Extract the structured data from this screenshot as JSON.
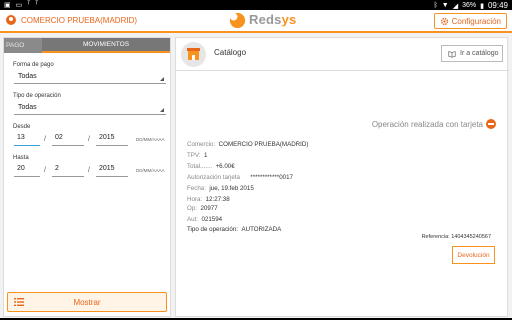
{
  "statusbar": {
    "left_icons": [
      "notification-icon",
      "tv-icon",
      "t-icon",
      "t2-icon"
    ],
    "left_glyphs": [
      "▣",
      "▭",
      "ᵀ",
      "ᵀ"
    ],
    "battery": "36%",
    "time": "09:49"
  },
  "appbar": {
    "merchant": "COMERCIO PRUEBA(MADRID)",
    "logo_text_a": "Reds",
    "logo_text_b": "ys",
    "config_label": "Configuración"
  },
  "left": {
    "tab_pago": "PAGO",
    "tab_movimientos": "MOVIMIENTOS",
    "forma_pago_label": "Forma de pago",
    "forma_pago_value": "Todas",
    "tipo_op_label": "Tipo de operación",
    "tipo_op_value": "Todas",
    "desde_label": "Desde",
    "desde": {
      "dd": "13",
      "mm": "02",
      "yyyy": "2015"
    },
    "hasta_label": "Hasta",
    "hasta": {
      "dd": "20",
      "mm": "2",
      "yyyy": "2015"
    },
    "date_sep": "/",
    "date_format": "DD/MM/AAAA",
    "mostrar_label": "Mostrar"
  },
  "right": {
    "catalogo_title": "Catálogo",
    "ir_catalogo_label": "Ir a catálogo",
    "op_title": "Operación realizada con tarjeta",
    "details": {
      "comercio_label": "Comercio:",
      "comercio_value": "COMERCIO PRUEBA(MADRID)",
      "tpv_label": "TPV:",
      "tpv_value": "1",
      "total_label": "Total.......",
      "total_value": "+6.00€",
      "tarjeta_label": "Autorización tarjeta",
      "tarjeta_value": "************0017",
      "fecha_label": "Fecha:",
      "fecha_value": "jue, 19.feb 2015",
      "hora_label": "Hora:",
      "hora_value": "12:27:38",
      "op_label": "Op:",
      "op_value": "20977",
      "aut_label": "Aut:",
      "aut_value": "021594",
      "tipo_label": "Tipo de operación:",
      "tipo_value": "AUTORIZADA"
    },
    "referencia": "Referencia: 1404345240567",
    "devolucion_label": "Devolución"
  },
  "colors": {
    "accent": "#f7931e",
    "accent_dark": "#e8661a",
    "tab_bg": "#8a8a8a"
  }
}
